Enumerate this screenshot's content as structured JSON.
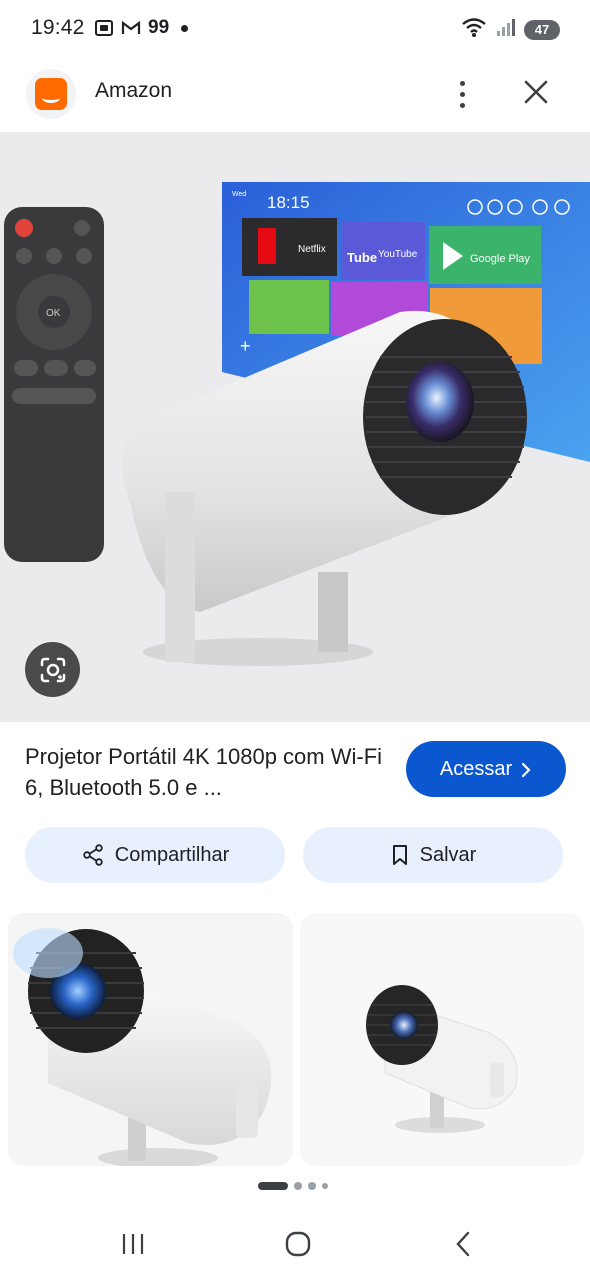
{
  "status_bar": {
    "time": "19:42",
    "notification_count": "99",
    "battery": "47",
    "icons": [
      "screenshot-icon",
      "gmail-icon",
      "dot-icon",
      "wifi-icon",
      "signal-icon",
      "battery-icon"
    ]
  },
  "app_bar": {
    "title": "Amazon",
    "favicon_color": "#ff6a00",
    "icons": [
      "more-vert-icon",
      "close-icon"
    ]
  },
  "hero": {
    "screen_time": "18:15",
    "apps": [
      "Netflix",
      "YouTube",
      "Google Play"
    ],
    "lens_icon": "google-lens-icon"
  },
  "product": {
    "title": "Projetor Portátil 4K 1080p com Wi-Fi 6, Bluetooth 5.0 e ...",
    "visit_label": "Acessar",
    "visit_color": "#0b57d0"
  },
  "actions": {
    "share_label": "Compartilhar",
    "save_label": "Salvar",
    "pill_color": "#e8f0fe"
  },
  "pagination": {
    "count": 4,
    "active_index": 0
  },
  "nav": {
    "icons": [
      "recents-icon",
      "home-icon",
      "back-icon"
    ]
  }
}
